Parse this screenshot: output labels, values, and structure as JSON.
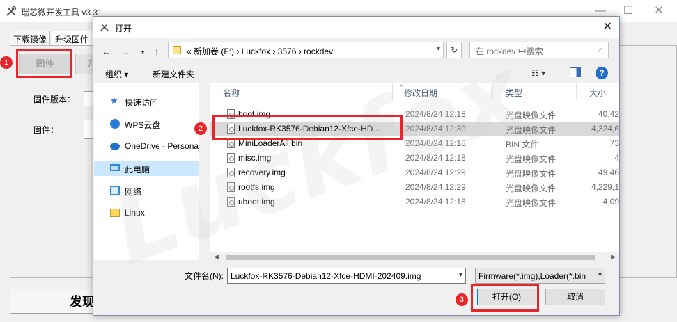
{
  "bg_app": {
    "title": "瑞芯微开发工具 v3.31",
    "tabs": [
      "下载镜像",
      "升级固件"
    ],
    "firmware_button": "固件",
    "upgrade_button": "升",
    "firmware_version_label": "固件版本：",
    "firmware_label": "固件：",
    "status_text": "发现"
  },
  "dialog": {
    "title": "打开",
    "close_symbol": "✕",
    "breadcrumb": [
      "新加卷 (F:)",
      "Luckfox",
      "3576",
      "rockdev"
    ],
    "breadcrumb_text": "«  新加卷 (F:)  ›  Luckfox  ›  3576  ›  rockdev",
    "search_placeholder": "在 rockdev 中搜索",
    "toolbar": {
      "organize": "组织 ▾",
      "new_folder": "新建文件夹",
      "help": "?"
    },
    "nav": [
      {
        "label": "快速访问",
        "icon": "star-icon"
      },
      {
        "label": "WPS云盘",
        "icon": "cloud-icon"
      },
      {
        "label": "OneDrive - Personal",
        "icon": "onedrive-icon"
      },
      {
        "label": "此电脑",
        "icon": "computer-icon",
        "selected": true
      },
      {
        "label": "网络",
        "icon": "network-icon"
      },
      {
        "label": "Linux",
        "icon": "folder-icon"
      }
    ],
    "columns": [
      "名称",
      "修改日期",
      "类型",
      "大小"
    ],
    "files": [
      {
        "name": "boot.img",
        "date": "2024/8/24 12:18",
        "type": "光盘映像文件",
        "size": "40,42"
      },
      {
        "name": "Luckfox-RK3576-Debian12-Xfce-HD...",
        "date": "2024/8/24 12:30",
        "type": "光盘映像文件",
        "size": "4,324,6",
        "selected": true
      },
      {
        "name": "MiniLoaderAll.bin",
        "date": "2024/8/24 12:18",
        "type": "BIN 文件",
        "size": "73"
      },
      {
        "name": "misc.img",
        "date": "2024/8/24 12:18",
        "type": "光盘映像文件",
        "size": "4"
      },
      {
        "name": "recovery.img",
        "date": "2024/8/24 12:29",
        "type": "光盘映像文件",
        "size": "49,46"
      },
      {
        "name": "rootfs.img",
        "date": "2024/8/24 12:29",
        "type": "光盘映像文件",
        "size": "4,229,1"
      },
      {
        "name": "uboot.img",
        "date": "2024/8/24 12:18",
        "type": "光盘映像文件",
        "size": "4,09"
      }
    ],
    "filename_label": "文件名(N):",
    "filename_value": "Luckfox-RK3576-Debian12-Xfce-HDMI-202409.img",
    "filter_value": "Firmware(*.img),Loader(*.bin",
    "open_button": "打开(O)",
    "cancel_button": "取消"
  },
  "annotations": {
    "step1": "1",
    "step2": "2",
    "step3": "3",
    "color": "#e8252a"
  },
  "watermark": "Luckfox"
}
